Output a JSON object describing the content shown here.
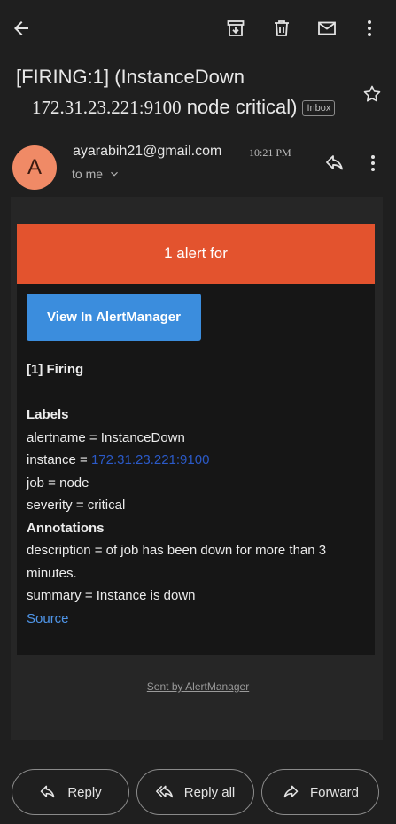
{
  "subject": {
    "line1": "[FIRING:1]  (InstanceDown",
    "line2_ip": "172.31.23.221:9100",
    "line2_rest": " node critical)",
    "label": "Inbox"
  },
  "message": {
    "avatar_letter": "A",
    "sender": "ayarabih21@gmail.com",
    "time": "10:21 PM",
    "recipient": "to me"
  },
  "alert": {
    "banner": "1 alert for",
    "button": "View In AlertManager",
    "firing": "[1] Firing",
    "labels_heading": "Labels",
    "alertname": "alertname = InstanceDown",
    "instance_prefix": "instance = ",
    "instance_value": "172.31.23.221:9100",
    "job": "job = node",
    "severity": "severity = critical",
    "annotations_heading": "Annotations",
    "description_1": "description = of job has been down for more than 3",
    "description_2": "minutes.",
    "summary": "summary = Instance is down",
    "source": "Source"
  },
  "footer_text": "Sent by AlertManager",
  "actions": {
    "reply": "Reply",
    "reply_all": "Reply all",
    "forward": "Forward"
  },
  "colors": {
    "banner": "#e3532e",
    "button": "#3b8ddd",
    "avatar": "#f08a66",
    "background": "#1f1f1f"
  }
}
